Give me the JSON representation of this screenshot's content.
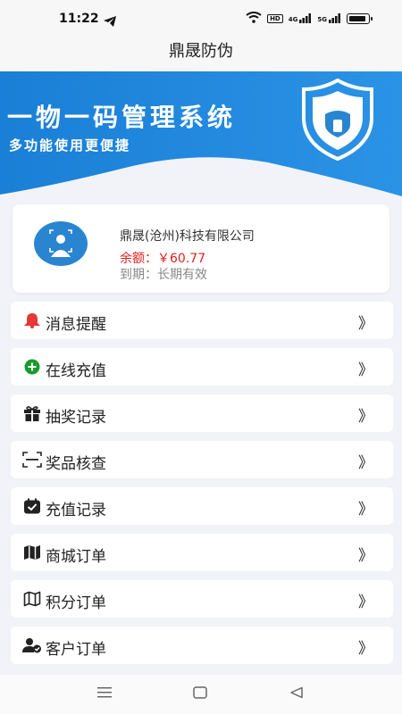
{
  "status": {
    "time": "11:22",
    "hd": "HD",
    "net1": "4G",
    "net2": "5G"
  },
  "header": {
    "title": "鼎晟防伪"
  },
  "banner": {
    "title": "一物一码管理系统",
    "subtitle": "多功能使用更便捷"
  },
  "profile": {
    "company": "鼎晟(沧州)科技有限公司",
    "balance_label": "余额：",
    "balance_value": "￥60.77",
    "expire_label": "到期：",
    "expire_value": "长期有效"
  },
  "menu": [
    {
      "label": "消息提醒",
      "icon": "bell-icon"
    },
    {
      "label": "在线充值",
      "icon": "plus-circle-icon"
    },
    {
      "label": "抽奖记录",
      "icon": "gift-icon"
    },
    {
      "label": "奖品核查",
      "icon": "scan-icon"
    },
    {
      "label": "充值记录",
      "icon": "calendar-check-icon"
    },
    {
      "label": "商城订单",
      "icon": "map-icon"
    },
    {
      "label": "积分订单",
      "icon": "map-outline-icon"
    },
    {
      "label": "客户订单",
      "icon": "user-check-icon"
    }
  ],
  "menu_arrow": "》",
  "colors": {
    "primary": "#2a85d1",
    "danger": "#e02020",
    "bell": "#e53935",
    "recharge": "#1a9a2c"
  }
}
